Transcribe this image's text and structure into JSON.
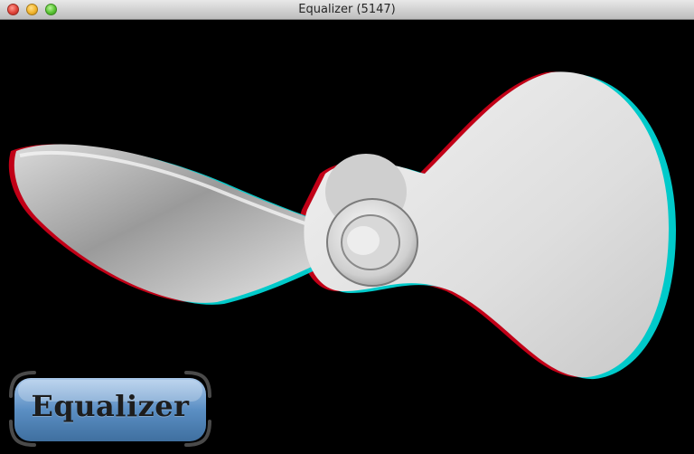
{
  "window": {
    "title": "Equalizer (5147)"
  },
  "logo": {
    "text": "Equalizer"
  },
  "colors": {
    "viewport_background": "#000000",
    "anaglyph_red": "#e0001a",
    "anaglyph_cyan": "#00e6e6",
    "model_surface": "#e8e8e8",
    "logo_fill": "#5b8fc4"
  },
  "icons": {
    "close": "close-button-red",
    "minimize": "minimize-button-yellow",
    "zoom": "zoom-button-green"
  }
}
